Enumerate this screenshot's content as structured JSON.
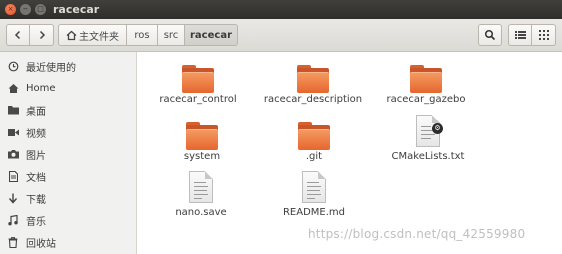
{
  "window": {
    "title": "racecar"
  },
  "titlebar_controls": {
    "close": "×",
    "minimize": "−",
    "maximize": "□"
  },
  "toolbar": {
    "back_icon": "chevron-left-icon",
    "forward_icon": "chevron-right-icon",
    "breadcrumb": [
      "主文件夹",
      "ros",
      "src",
      "racecar"
    ],
    "search_icon": "search-icon",
    "list_view_icon": "list-icon",
    "grid_view_icon": "grid-icon"
  },
  "sidebar": {
    "items": [
      {
        "label": "最近使用的",
        "icon": "clock-icon"
      },
      {
        "label": "Home",
        "icon": "home-icon"
      },
      {
        "label": "桌面",
        "icon": "desktop-folder-icon"
      },
      {
        "label": "视频",
        "icon": "video-icon"
      },
      {
        "label": "图片",
        "icon": "camera-icon"
      },
      {
        "label": "文档",
        "icon": "document-icon"
      },
      {
        "label": "下载",
        "icon": "download-icon"
      },
      {
        "label": "音乐",
        "icon": "music-icon"
      },
      {
        "label": "回收站",
        "icon": "trash-icon"
      }
    ]
  },
  "files": [
    {
      "name": "racecar_control",
      "type": "folder"
    },
    {
      "name": "racecar_description",
      "type": "folder"
    },
    {
      "name": "racecar_gazebo",
      "type": "folder"
    },
    {
      "name": "system",
      "type": "folder"
    },
    {
      "name": ".git",
      "type": "folder"
    },
    {
      "name": "CMakeLists.txt",
      "type": "text-script"
    },
    {
      "name": "nano.save",
      "type": "text"
    },
    {
      "name": "README.md",
      "type": "text"
    }
  ],
  "watermark": "https://blog.csdn.net/qq_42559980"
}
